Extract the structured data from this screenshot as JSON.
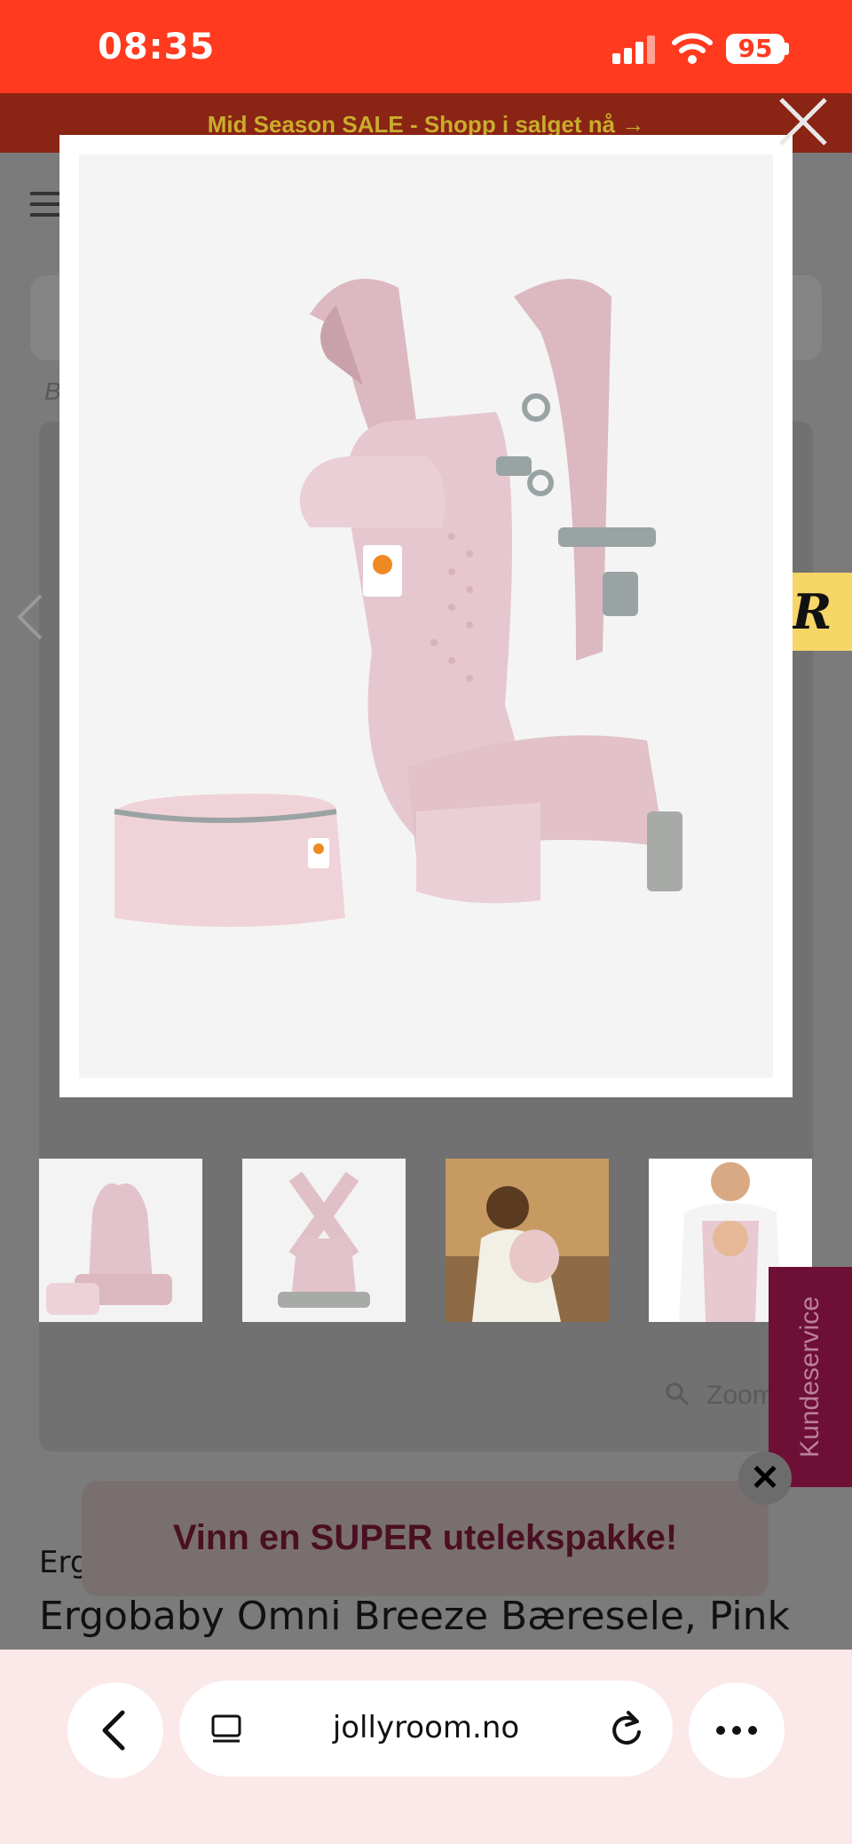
{
  "status_bar": {
    "time": "08:35",
    "battery": "95",
    "signal_icon": "cellular-signal-icon",
    "wifi_icon": "wifi-icon"
  },
  "banner": {
    "text": "Mid Season SALE - Shopp i salget nå →"
  },
  "page": {
    "breadcrumb_initial": "B",
    "brand": "Ergobaby",
    "product_title": "Ergobaby Omni Breeze Bæresele, Pink",
    "zoom_label": "Zoom",
    "reviews_badge": "R",
    "customer_service": "Kundeservice"
  },
  "lightbox": {
    "image_alt": "Ergobaby Omni Breeze baby carrier in pink with matching pouch",
    "close_icon": "close-icon"
  },
  "thumbnails": [
    {
      "label": "Carrier front with pouch"
    },
    {
      "label": "Carrier back straps"
    },
    {
      "label": "Mother carrying baby outdoors"
    },
    {
      "label": "Father carrying baby"
    }
  ],
  "promo": {
    "text": "Vinn en SUPER utelekspakke!"
  },
  "browser": {
    "url": "jollyroom.no"
  },
  "colors": {
    "status_bar": "#ff3a1f",
    "banner": "#8a2414",
    "banner_text": "#c8ad2b",
    "customer_service": "#6e0f35",
    "reviews_badge": "#f7d668",
    "carrier_pink": "#e6c7cf"
  }
}
